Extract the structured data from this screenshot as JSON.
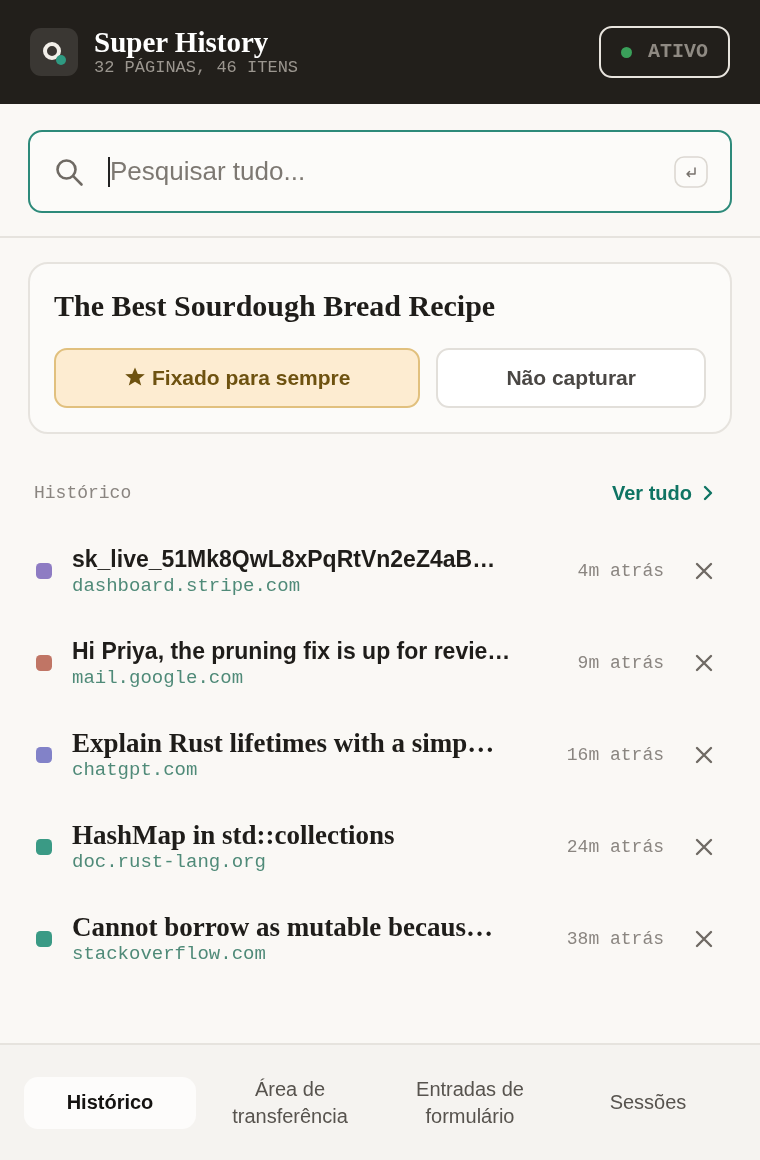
{
  "header": {
    "title": "Super History",
    "subtitle": "32 PÁGINAS, 46 ITENS",
    "status": {
      "label": "ATIVO",
      "on": true
    }
  },
  "search": {
    "placeholder": "Pesquisar tudo..."
  },
  "current_page": {
    "title": "The Best Sourdough Bread Recipe",
    "actions": [
      {
        "label": "Fixado para sempre",
        "kind": "pin",
        "selected": true
      },
      {
        "label": "Não capturar",
        "kind": "exclude",
        "selected": false
      }
    ]
  },
  "history": {
    "heading": "Histórico",
    "link": "Ver tudo",
    "items": [
      {
        "kind": "text",
        "title": "sk_live_51Mk8QwL8xPqRtVn2eZ4aB…",
        "domain": "dashboard.stripe.com",
        "time": "4m atrás",
        "color": "#8e7cc3"
      },
      {
        "kind": "text",
        "title": "Hi Priya, the pruning fix is up for revie…",
        "domain": "mail.google.com",
        "time": "9m atrás",
        "color": "#c07565"
      },
      {
        "kind": "page",
        "title": "Explain Rust lifetimes with a simp…",
        "domain": "chatgpt.com",
        "time": "16m atrás",
        "color": "#8282c8"
      },
      {
        "kind": "page",
        "title": "HashMap in std::collections",
        "domain": "doc.rust-lang.org",
        "time": "24m atrás",
        "color": "#3a9a85"
      },
      {
        "kind": "page",
        "title": "Cannot borrow as mutable becaus…",
        "domain": "stackoverflow.com",
        "time": "38m atrás",
        "color": "#3a9a85"
      }
    ]
  },
  "tabs": [
    {
      "label": "Histórico",
      "selected": true
    },
    {
      "label": "Área de transferência",
      "selected": false
    },
    {
      "label": "Entradas de formulário",
      "selected": false
    },
    {
      "label": "Sessões",
      "selected": false
    }
  ]
}
